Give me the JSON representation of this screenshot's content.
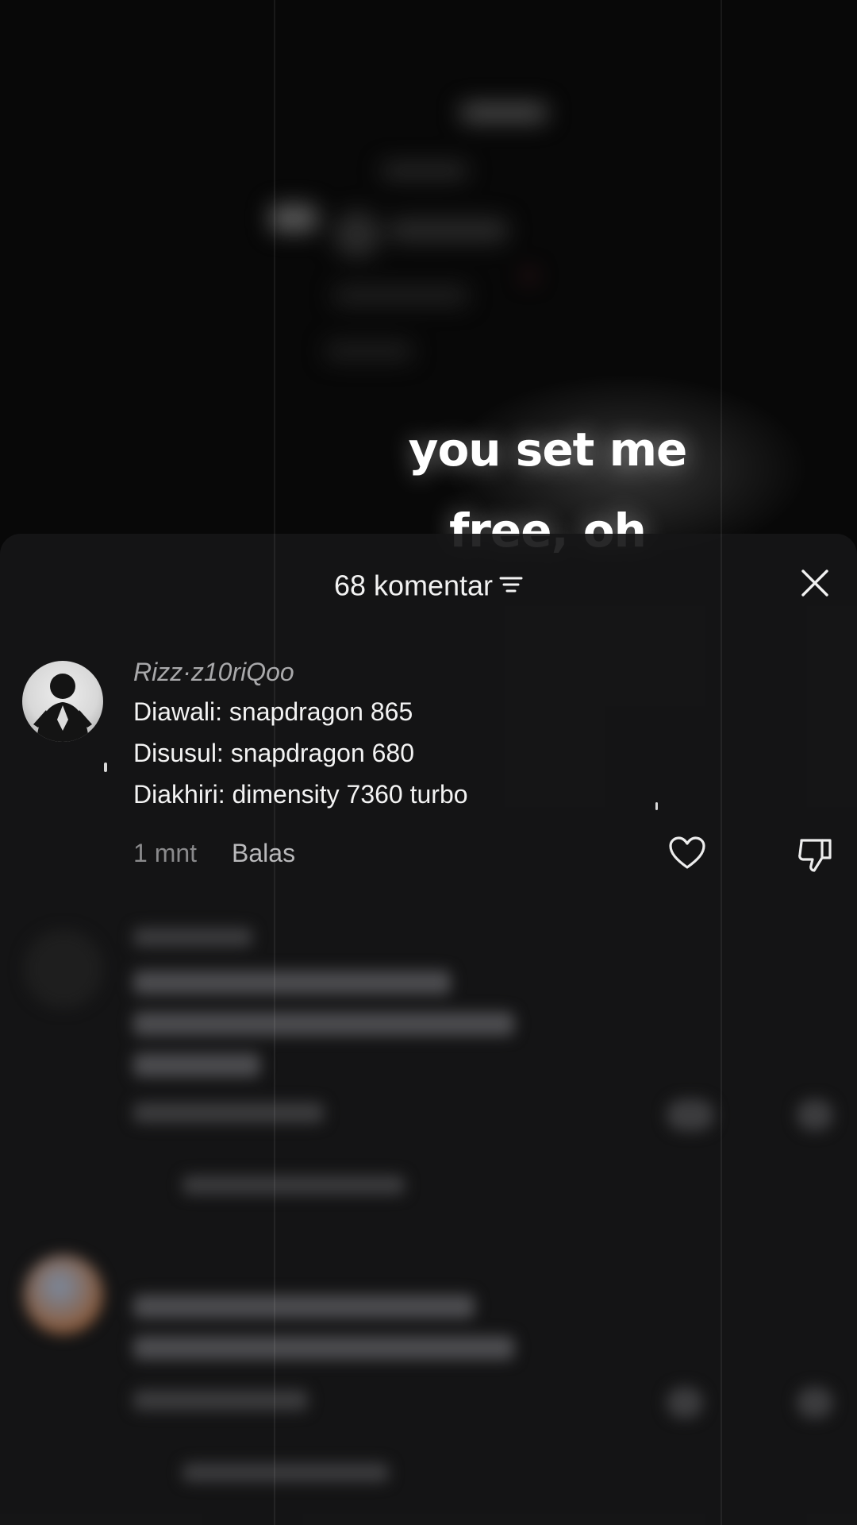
{
  "video": {
    "lyric_lines": [
      "you set me",
      "free, oh"
    ]
  },
  "comments_sheet": {
    "count_label": "68 komentar",
    "sort_icon": "sort-lines-icon",
    "close_icon": "close-icon",
    "comments": [
      {
        "username": "Rizz·z10riQoo",
        "lines": [
          "Diawali: snapdragon 865",
          "Disusul: snapdragon 680",
          "Diakhiri: dimensity 7360 turbo"
        ],
        "time": "1 mnt",
        "reply_label": "Balas",
        "like_icon": "heart-outline-icon",
        "dislike_icon": "thumbs-down-icon"
      }
    ]
  },
  "colors": {
    "background": "#080808",
    "sheet": "#161617",
    "text_primary": "#f3f3f3",
    "text_secondary": "#8a8a8c"
  }
}
